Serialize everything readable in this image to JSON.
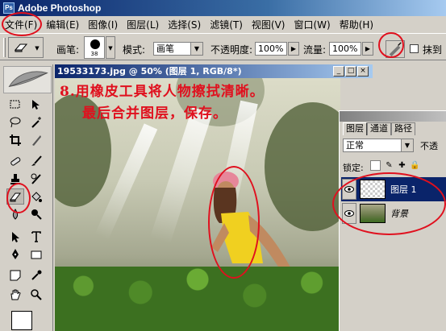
{
  "app": {
    "title": "Adobe Photoshop",
    "icon": "ps"
  },
  "menu": [
    "文件(F)",
    "编辑(E)",
    "图像(I)",
    "图层(L)",
    "选择(S)",
    "滤镜(T)",
    "视图(V)",
    "窗口(W)",
    "帮助(H)"
  ],
  "options": {
    "brush_label": "画笔:",
    "brush_size": "38",
    "mode_label": "模式:",
    "mode_value": "画笔",
    "opacity_label": "不透明度:",
    "opacity_value": "100%",
    "flow_label": "流量:",
    "flow_value": "100%",
    "erase_history_label": "抹到"
  },
  "document": {
    "title": "19533173.jpg @ 50% (图层 1, RGB/8*)",
    "annotation_line1": "8.用橡皮工具将人物擦拭清晰。",
    "annotation_line2": "最后合并图层，保存。"
  },
  "layers_panel": {
    "tabs": [
      "图层",
      "通道",
      "路径"
    ],
    "blend_mode": "正常",
    "opacity_label": "不透",
    "lock_label": "锁定:",
    "layers": [
      {
        "name": "图层 1",
        "selected": true,
        "thumb": "transparent"
      },
      {
        "name": "背景",
        "selected": false,
        "thumb": "photo"
      }
    ]
  },
  "colors": {
    "annotation": "#e0101e",
    "titlebar_start": "#0a246a",
    "titlebar_end": "#a6caf0"
  }
}
